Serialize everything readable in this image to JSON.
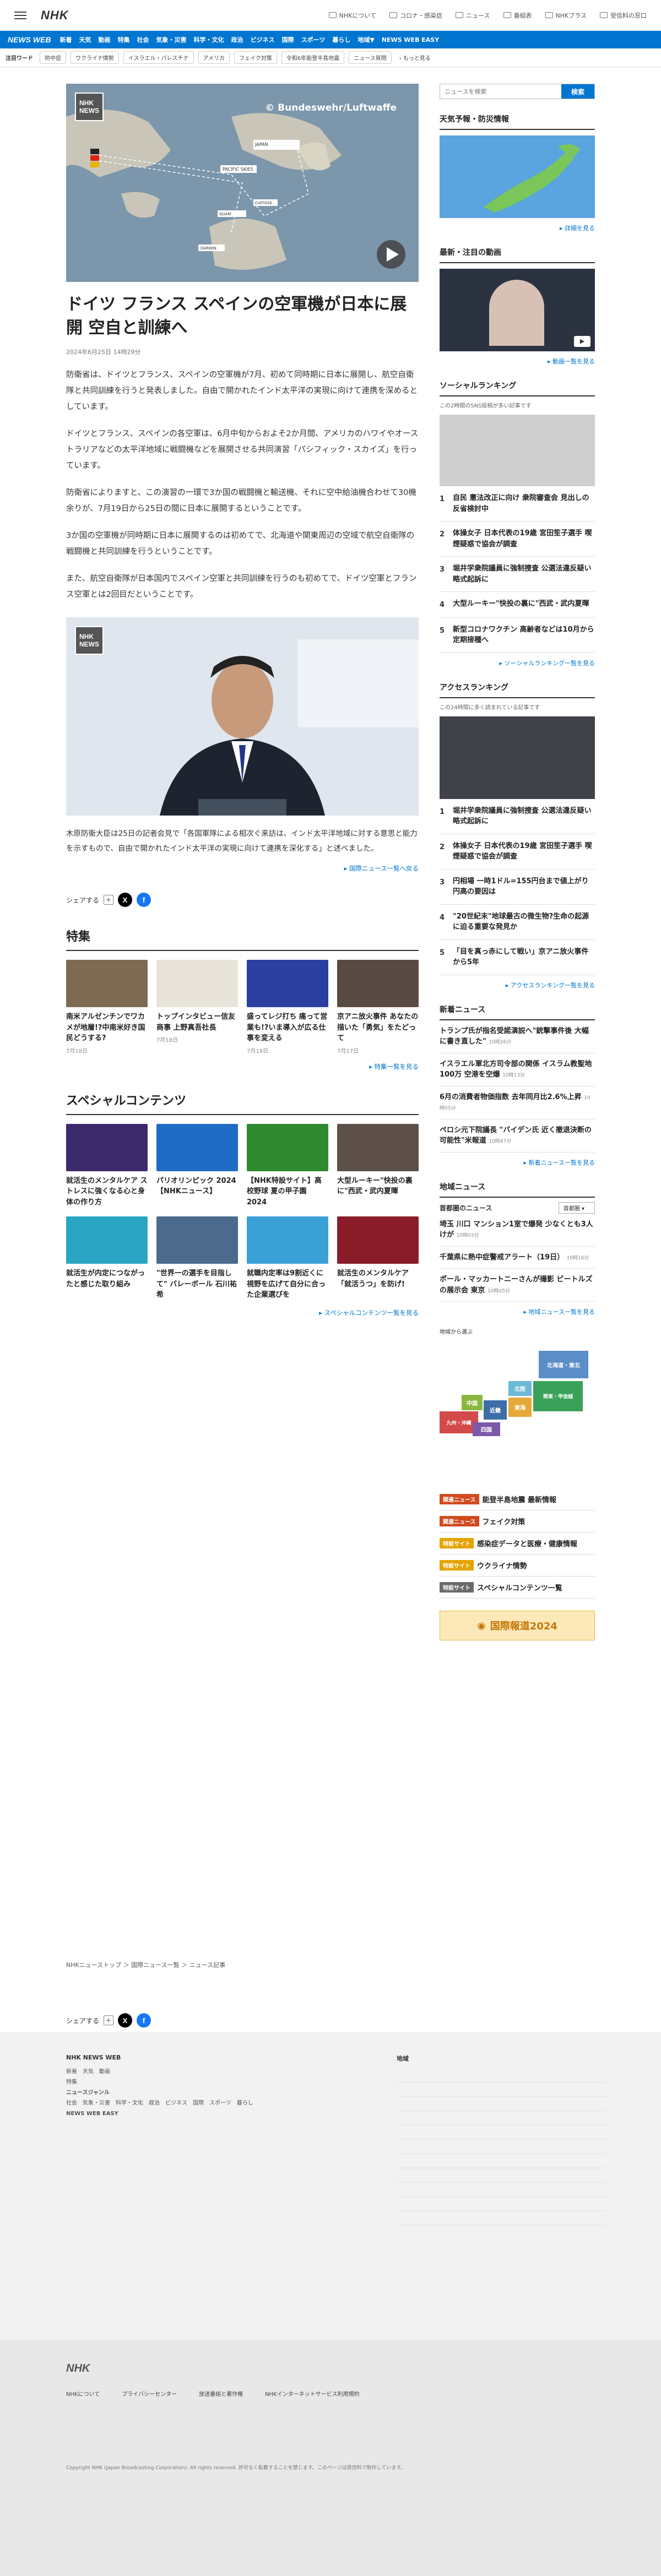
{
  "header": {
    "logo": "NHK",
    "links": [
      "NHKについて",
      "コロナ・感染症",
      "ニュース",
      "番組表",
      "NHKプラス",
      "受信料の窓口"
    ]
  },
  "nav": {
    "brand": "NEWS WEB",
    "items": [
      "新着",
      "天気",
      "動画",
      "特集",
      "社会",
      "気象・災害",
      "科学・文化",
      "政治",
      "ビジネス",
      "国際",
      "スポーツ",
      "暮らし",
      "地域▼"
    ],
    "easy": "NEWS WEB EASY"
  },
  "keywords": {
    "label": "注目ワード",
    "items": [
      "熱中症",
      "ウクライナ情勢",
      "イスラエル・パレスチナ",
      "アメリカ",
      "フェイク対策",
      "令和6年能登半島地震",
      "ニュース質問"
    ],
    "more": "もっと見る"
  },
  "article": {
    "photo_credit": "© Bundeswehr/Luftwaffe",
    "map_labels": [
      "JAPAN",
      "PACIFIC SKIES",
      "CHITOSE",
      "HYAKURI",
      "NYUTABARU",
      "DARWIN",
      "GUAM",
      "HAWAII"
    ],
    "title": "ドイツ フランス スペインの空軍機が日本に展開 空自と訓練へ",
    "date": "2024年6月25日 14時29分",
    "paragraphs": [
      "防衛省は、ドイツとフランス、スペインの空軍機が7月、初めて同時期に日本に展開し、航空自衛隊と共同訓練を行うと発表しました。自由で開かれたインド太平洋の実現に向けて連携を深めるとしています。",
      "ドイツとフランス、スペインの各空軍は、6月中旬からおよそ2か月間、アメリカのハワイやオーストラリアなどの太平洋地域に戦闘機などを展開させる共同演習「パシフィック・スカイズ」を行っています。",
      "防衛省によりますと、この演習の一環で3か国の戦闘機と輸送機、それに空中給油機合わせて30機余りが、7月19日から25日の間に日本に展開するということです。",
      "3か国の空軍機が同時期に日本に展開するのは初めてで、北海道や関東周辺の空域で航空自衛隊の戦闘機と共同訓練を行うということです。",
      "また、航空自衛隊が日本国内でスペイン空軍と共同訓練を行うのも初めてで、ドイツ空軍とフランス空軍とは2回目だということです。"
    ],
    "paragraph2": "木原防衛大臣は25日の記者会見で「各国軍隊による相次ぐ来訪は、インド太平洋地域に対する意思と能力を示すもので、自由で開かれたインド太平洋の実現に向けて連携を深化する」と述べました。",
    "related": "国際ニュース一覧へ戻る",
    "share": "シェアする"
  },
  "features": {
    "title": "特集",
    "items": [
      {
        "t": "南米アルゼンチンでワカメが地層!?中南米好き国民どうする?",
        "d": "7月18日"
      },
      {
        "t": "トップインタビュー信友商事 上野真吾社長",
        "d": "7月18日"
      },
      {
        "t": "盛ってレジ打ち 痛って営業も!?いま導入が広る仕事を変える",
        "d": "7月18日"
      },
      {
        "t": "京アニ放火事件 あなたの描いた「勇気」をたどって",
        "d": "7月17日"
      }
    ],
    "more": "特集一覧を見る"
  },
  "special": {
    "title": "スペシャルコンテンツ",
    "items": [
      {
        "t": "就活生のメンタルケア ストレスに強くなる心と身体の作り方"
      },
      {
        "t": "パリオリンピック 2024【NHKニュース】"
      },
      {
        "t": "【NHK特設サイト】高校野球 夏の甲子園 2024"
      },
      {
        "t": "大型ルーキー\"快投の裏に\"西武・武内夏暉"
      },
      {
        "t": "就活生が内定につながったと感じた取り組み"
      },
      {
        "t": "\"世界一の選手を目指して\" バレーボール 石川祐希"
      },
      {
        "t": "就職内定率は9割近くに 視野を広げて自分に合った企業選びを"
      },
      {
        "t": "就活生のメンタルケア「就活うつ」を防げ!"
      }
    ],
    "more": "スペシャルコンテンツ一覧を見る"
  },
  "sidebar": {
    "search_placeholder": "ニュースを検索",
    "search_btn": "検索",
    "weather": "天気予報・防災情報",
    "weather_more": "詳細を見る",
    "video": "最新・注目の動画",
    "video_more": "動画一覧を見る",
    "social": "ソーシャルランキング",
    "social_sub": "この2時間のSNS投稿が多い記事です",
    "social_items": [
      "自民 憲法改正に向け 衆院審査会 見出しの反省検討中",
      "体操女子 日本代表の19歳 宮田笙子選手 喫煙疑惑で協会が調査",
      "堀井学衆院議員に強制捜査 公選法違反疑い 略式起訴に",
      "大型ルーキー\"快投の裏に\"西武・武内夏暉",
      "新型コロナワクチン 高齢者などは10月から定期接種へ"
    ],
    "social_more": "ソーシャルランキング一覧を見る",
    "access": "アクセスランキング",
    "access_sub": "この24時間に多く読まれている記事です",
    "access_items": [
      "堀井学衆院議員に強制捜査 公選法違反疑い 略式起訴に",
      "体操女子 日本代表の19歳 宮田笙子選手 喫煙疑惑で協会が調査",
      "円相場 一時1ドル=155円台まで値上がり 円高の要因は",
      "\"20世紀末\"地球最古の微生物?生命の起源に迫る重要な発見か",
      "「目を真っ赤にして戦い」京アニ放火事件から5年"
    ],
    "access_more": "アクセスランキング一覧を見る",
    "latest": "新着ニュース",
    "latest_items": [
      {
        "t": "トランプ氏が指名受諾演説へ\"銃撃事件後 大幅に書き直した\"",
        "d": "10時26分"
      },
      {
        "t": "イスラエル軍北方司令部の関係 イスラム教聖地100万 空港を空爆",
        "d": "10時13分"
      },
      {
        "t": "6月の消費者物価指数 去年同月比2.6%上昇",
        "d": "10時05分"
      },
      {
        "t": "ペロシ元下院議長 \"バイデン氏 近く撤退決断の可能性\"米報道",
        "d": "10時47分"
      }
    ],
    "latest_more": "新着ニュース一覧を見る",
    "local": "地域ニュース",
    "local_label": "首都圏のニュース",
    "local_select": "首都圏",
    "local_items": [
      {
        "t": "埼玉 川口 マンション1室で爆発 少なくとも3人けが",
        "d": "10時03分"
      },
      {
        "t": "千葉県に熱中症警戒アラート（19日）",
        "d": "10時16分"
      },
      {
        "t": "ポール・マッカートニーさんが撮影 ビートルズの展示会 東京",
        "d": "10時05分"
      }
    ],
    "local_more": "地域ニュース一覧を見る",
    "region_title": "地域から選ぶ",
    "regions": [
      "北海道・東北",
      "関東・甲信越",
      "東海",
      "近畿",
      "中国",
      "九州・沖縄",
      "北陸",
      "四国"
    ],
    "banners": [
      {
        "tag": "関連ニュース",
        "t": "能登半島地震 最新情報",
        "c": "#d14a1e"
      },
      {
        "tag": "関連ニュース",
        "t": "フェイク対策",
        "c": "#d14a1e"
      },
      {
        "tag": "特設サイト",
        "t": "感染症データと医療・健康情報",
        "c": "#e5a300"
      },
      {
        "tag": "特設サイト",
        "t": "ウクライナ情勢",
        "c": "#e5a300"
      },
      {
        "tag": "特設サイト",
        "t": "スペシャルコンテンツ一覧",
        "c": "#6a6a6a"
      }
    ],
    "promo": "国際報道2024"
  },
  "breadcrumb": [
    "NHKニューストップ",
    "国際ニュース一覧",
    "ニュース記事"
  ],
  "footer": {
    "col1_title": "NHK NEWS WEB",
    "col1": [
      "新着　天気　動画",
      "特集",
      "ニュースジャンル",
      "社会　気象・災害　科学・文化　政治　ビジネス　国際　スポーツ　暮らし",
      "NEWS WEB EASY"
    ],
    "col2_title": "地域"
  },
  "footer_bottom": {
    "logo": "NHK",
    "links": [
      "NHKについて",
      "プライバシーセンター",
      "放送番組と著作権",
      "NHKインターネットサービス利用規約"
    ],
    "copyright": "Copyright NHK (Japan Broadcasting Corporation). All rights reserved. 許可なく転載することを禁じます。このページは受信料で制作しています。"
  }
}
